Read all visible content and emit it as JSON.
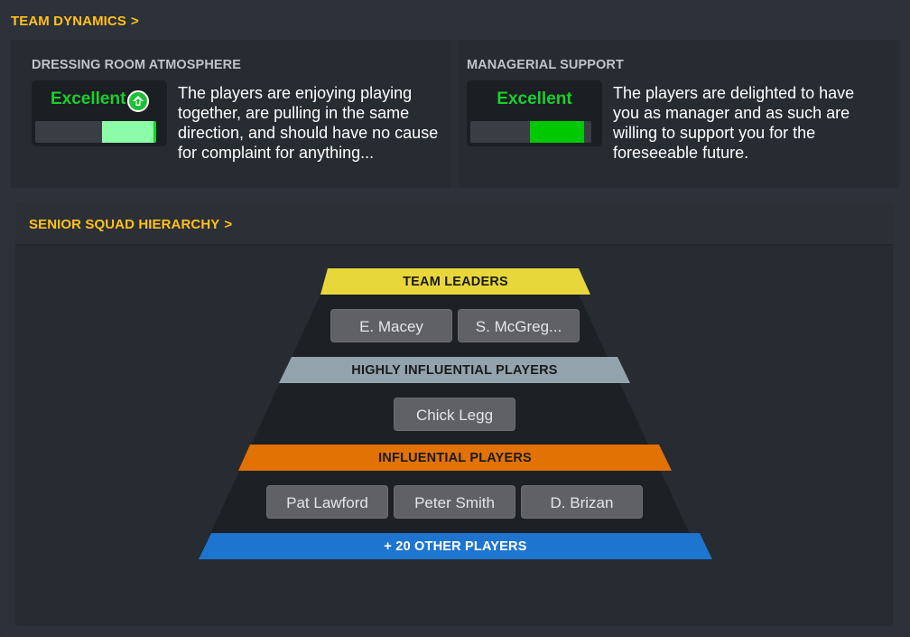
{
  "colors": {
    "accent": "#ffc21a",
    "rating_green": "#19cf2a",
    "meter_light": "#8dfca8",
    "meter_dark": "#00c800",
    "tier_leaders": "#e8d73a",
    "tier_highly": "#93a3ad",
    "tier_influential": "#e17203",
    "tier_other": "#1e75cf",
    "chip_bg": "#5f6167"
  },
  "team_dynamics": {
    "header": "TEAM DYNAMICS",
    "chevron": ">",
    "dressing_room": {
      "title": "DRESSING ROOM ATMOSPHERE",
      "rating": "Excellent",
      "trend_icon": "arrow-up-circle-icon",
      "meter_level": 0.45,
      "description": "The players are enjoying playing together, are pulling in the same direction, and should have no cause for complaint for anything..."
    },
    "managerial_support": {
      "title": "MANAGERIAL SUPPORT",
      "rating": "Excellent",
      "meter_level": 0.45,
      "description": "The players are delighted to have you as manager and as such are willing to support you for the foreseeable future."
    }
  },
  "hierarchy": {
    "header": "SENIOR SQUAD HIERARCHY",
    "chevron": ">",
    "tiers": {
      "leaders": {
        "label": "TEAM LEADERS",
        "players": [
          "E. Macey",
          "S. McGreg..."
        ]
      },
      "highly": {
        "label": "HIGHLY INFLUENTIAL PLAYERS",
        "players": [
          "Chick Legg"
        ]
      },
      "influential": {
        "label": "INFLUENTIAL PLAYERS",
        "players": [
          "Pat Lawford",
          "Peter Smith",
          "D. Brizan"
        ]
      },
      "other": {
        "label": "+ 20 OTHER PLAYERS"
      }
    }
  }
}
